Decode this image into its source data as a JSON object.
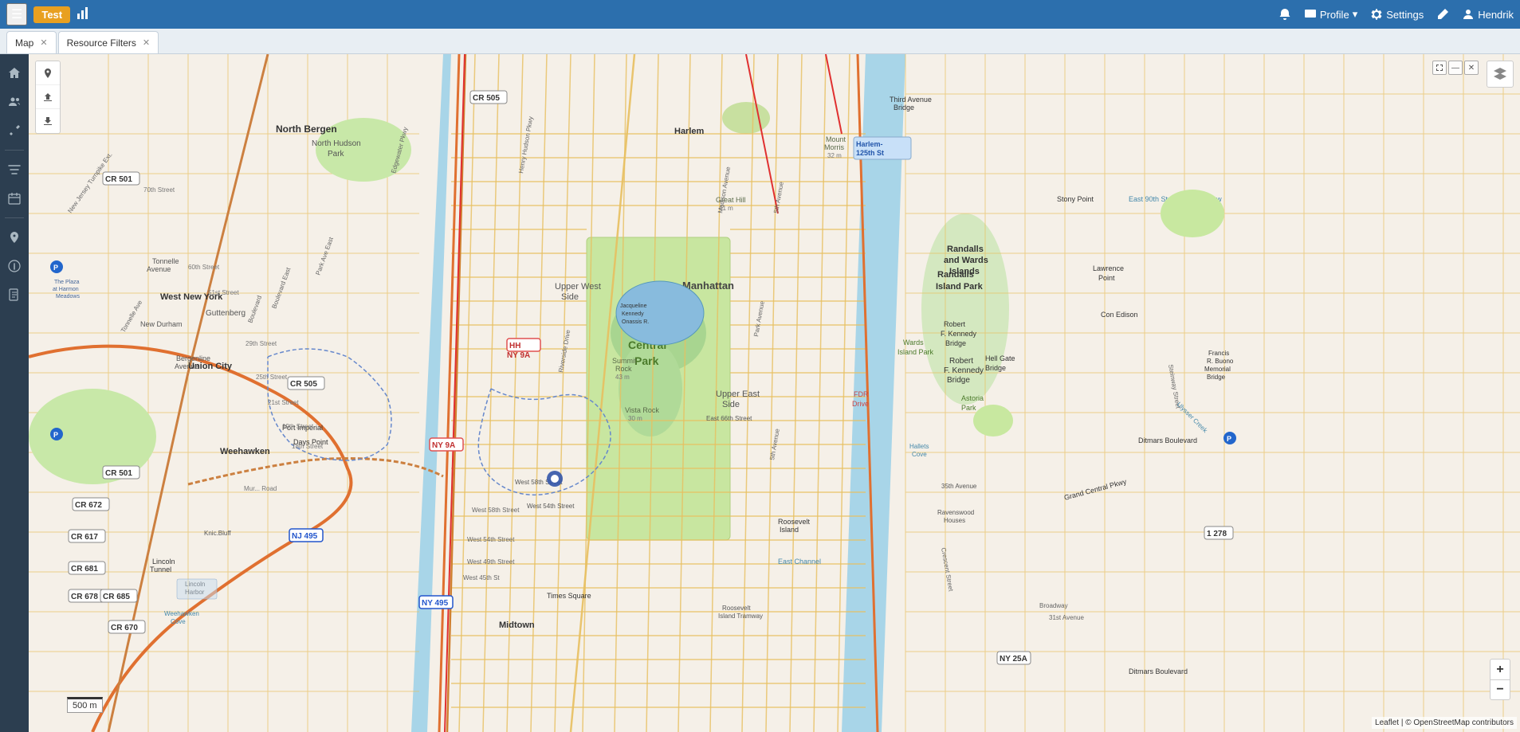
{
  "topbar": {
    "app_label": "Test",
    "profile_label": "Profile",
    "profile_dropdown": true,
    "settings_label": "Settings",
    "user_label": "Hendrik",
    "icons": {
      "hamburger": "☰",
      "barchart": "📊",
      "bell": "🔔",
      "profile": "👤",
      "settings": "⚙",
      "edit": "✏",
      "user": "👤"
    }
  },
  "tabs": [
    {
      "id": "map",
      "label": "Map",
      "active": true,
      "closable": true
    },
    {
      "id": "resource-filters",
      "label": "Resource Filters",
      "active": false,
      "closable": true
    }
  ],
  "sidebar": {
    "items": [
      {
        "id": "home",
        "icon": "⌂",
        "label": "Home"
      },
      {
        "id": "people",
        "icon": "👥",
        "label": "People"
      },
      {
        "id": "tools",
        "icon": "🔧",
        "label": "Tools"
      },
      {
        "id": "filters",
        "icon": "≡",
        "label": "Filters"
      },
      {
        "id": "calendar",
        "icon": "📅",
        "label": "Calendar"
      },
      {
        "id": "pin",
        "icon": "📍",
        "label": "Location"
      },
      {
        "id": "info",
        "icon": "ℹ",
        "label": "Info"
      },
      {
        "id": "docs",
        "icon": "📄",
        "label": "Documents"
      }
    ]
  },
  "map": {
    "center_label": "Manhattan",
    "scale_label": "500 m",
    "attribution": "Leaflet | © OpenStreetMap contributors",
    "zoom_in": "+",
    "zoom_out": "−"
  },
  "map_tools": [
    {
      "id": "marker",
      "icon": "📍",
      "label": "Add Marker"
    },
    {
      "id": "upload",
      "icon": "⬆",
      "label": "Upload"
    },
    {
      "id": "download",
      "icon": "⬇",
      "label": "Download"
    }
  ]
}
